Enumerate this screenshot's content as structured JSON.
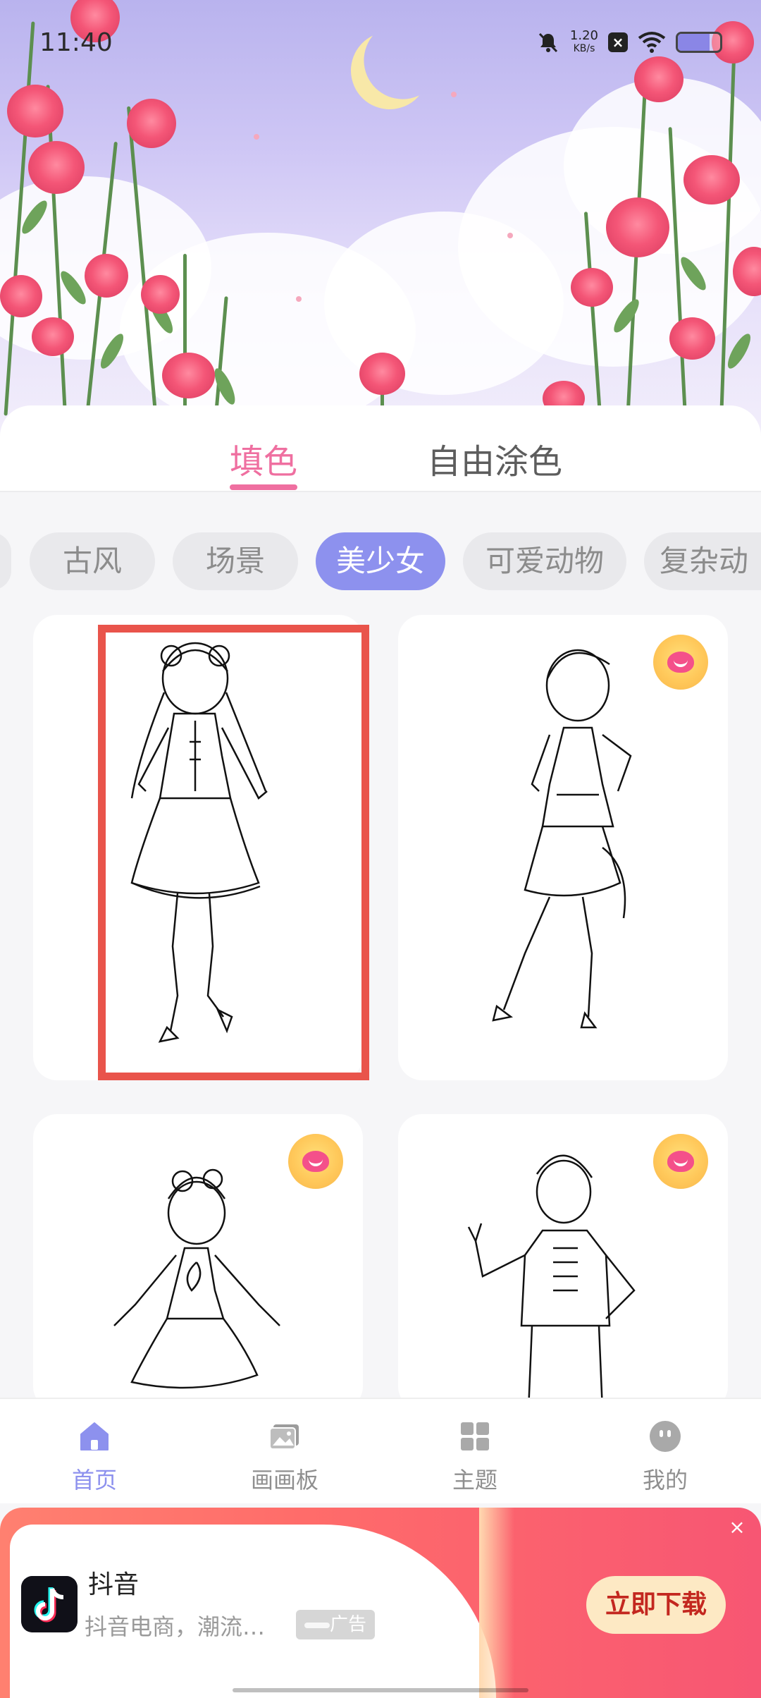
{
  "status_bar": {
    "time": "11:40",
    "net_speed_value": "1.20",
    "net_speed_unit": "KB/s",
    "x_badge": "×",
    "battery_percent": 75
  },
  "tabs": [
    {
      "label": "填色",
      "active": true
    },
    {
      "label": "自由涂色",
      "active": false
    }
  ],
  "categories": [
    "古风",
    "场景",
    "美少女",
    "可爱动物",
    "复杂动"
  ],
  "active_category": "美少女",
  "gallery": [
    {
      "subject": "girl in chinese dress",
      "premium": false,
      "selected": true
    },
    {
      "subject": "girl with hat and hand on hip",
      "premium": true,
      "selected": false
    },
    {
      "subject": "girl with flower dress",
      "premium": true,
      "selected": false
    },
    {
      "subject": "prince in uniform",
      "premium": true,
      "selected": false
    }
  ],
  "bottom_nav": [
    {
      "label": "首页",
      "icon": "home-icon",
      "active": true
    },
    {
      "label": "画画板",
      "icon": "gallery-icon",
      "active": false
    },
    {
      "label": "主题",
      "icon": "grid-icon",
      "active": false
    },
    {
      "label": "我的",
      "icon": "profile-icon",
      "active": false
    }
  ],
  "ad": {
    "app_name": "抖音",
    "description": "抖音电商，潮流…",
    "tag": "广告",
    "cta": "立即下载",
    "close": "×"
  },
  "colors": {
    "accent_pink": "#ef6fa0",
    "accent_purple": "#8d91ee",
    "ad_red": "#ff6c6a",
    "highlight_red": "#e9544b"
  }
}
